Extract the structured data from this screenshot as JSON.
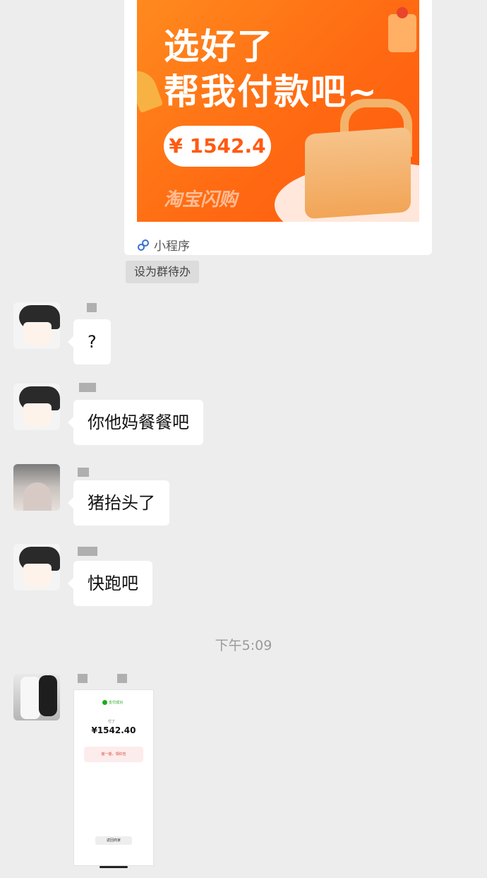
{
  "mini_program": {
    "headline_1": "选好了",
    "headline_2": "帮我付款吧~",
    "price": "¥ 1542.4",
    "brand": "淘宝闪购",
    "type_label": "小程序"
  },
  "group_todo_label": "设为群待办",
  "messages": [
    {
      "text": "?"
    },
    {
      "text": "你他妈餐餐吧"
    },
    {
      "text": "猪抬头了"
    },
    {
      "text": "快跑吧"
    }
  ],
  "timestamp": "下午5:09",
  "payment_screenshot": {
    "status_ok": "支付成功",
    "paid_label": "付了",
    "amount": "¥1542.40",
    "promo_text": "摇一摇，领红包",
    "done_button": "返回商家"
  },
  "colors": {
    "chat_background": "#ededed",
    "promo_orange": "#ff6a12",
    "bubble": "#ffffff"
  }
}
